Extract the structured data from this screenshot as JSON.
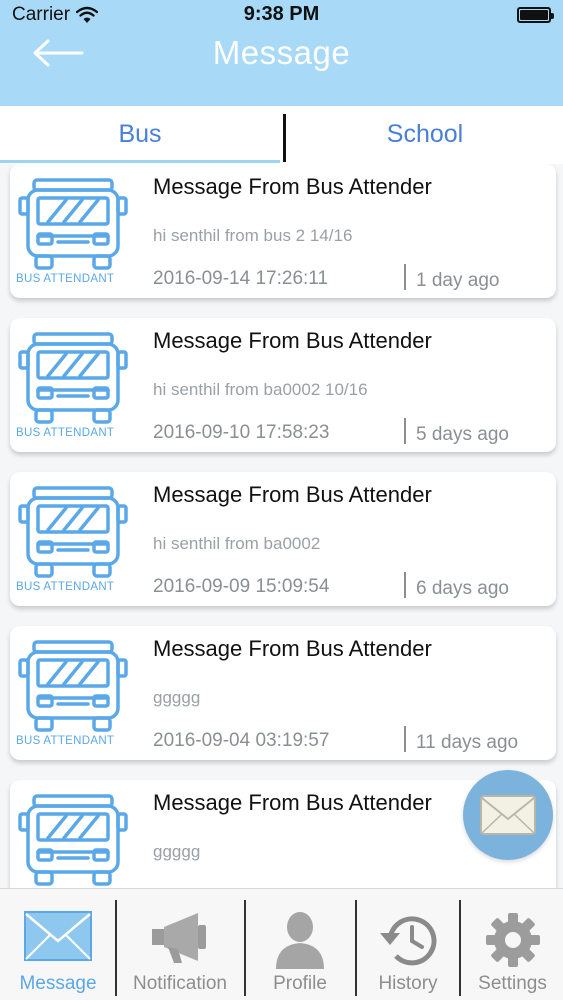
{
  "status_bar": {
    "carrier": "Carrier",
    "time": "9:38 PM"
  },
  "nav": {
    "title": "Message",
    "back_icon": "back-arrow-icon"
  },
  "tabs": [
    {
      "label": "Bus",
      "selected": true
    },
    {
      "label": "School",
      "selected": false
    }
  ],
  "messages": [
    {
      "sender_label": "BUS ATTENDANT",
      "title": "Message From Bus Attender",
      "body": "hi senthil from bus 2 14/16",
      "date": "2016-09-14 17:26:11",
      "ago": "1 day  ago"
    },
    {
      "sender_label": "BUS ATTENDANT",
      "title": "Message From Bus Attender",
      "body": "hi senthil from ba0002 10/16",
      "date": "2016-09-10 17:58:23",
      "ago": "5 days  ago"
    },
    {
      "sender_label": "BUS ATTENDANT",
      "title": "Message From Bus Attender",
      "body": "hi senthil from ba0002",
      "date": "2016-09-09 15:09:54",
      "ago": "6 days  ago"
    },
    {
      "sender_label": "BUS ATTENDANT",
      "title": "Message From Bus Attender",
      "body": "ggggg",
      "date": "2016-09-04 03:19:57",
      "ago": "11 days  ago"
    },
    {
      "sender_label": "",
      "title": "Message From Bus Attender",
      "body": "ggggg",
      "date": "",
      "ago": ""
    }
  ],
  "fab": {
    "icon": "envelope-icon"
  },
  "tabbar": [
    {
      "label": "Message",
      "icon": "envelope-icon",
      "active": true
    },
    {
      "label": "Notification",
      "icon": "megaphone-icon",
      "active": false
    },
    {
      "label": "Profile",
      "icon": "person-icon",
      "active": false
    },
    {
      "label": "History",
      "icon": "history-clock-icon",
      "active": false
    },
    {
      "label": "Settings",
      "icon": "gear-icon",
      "active": false
    }
  ],
  "colors": {
    "nav_bg": "#a8daf8",
    "accent": "#4a7fd6",
    "icon_blue": "#5aa8e8",
    "muted": "#8a8f94"
  }
}
